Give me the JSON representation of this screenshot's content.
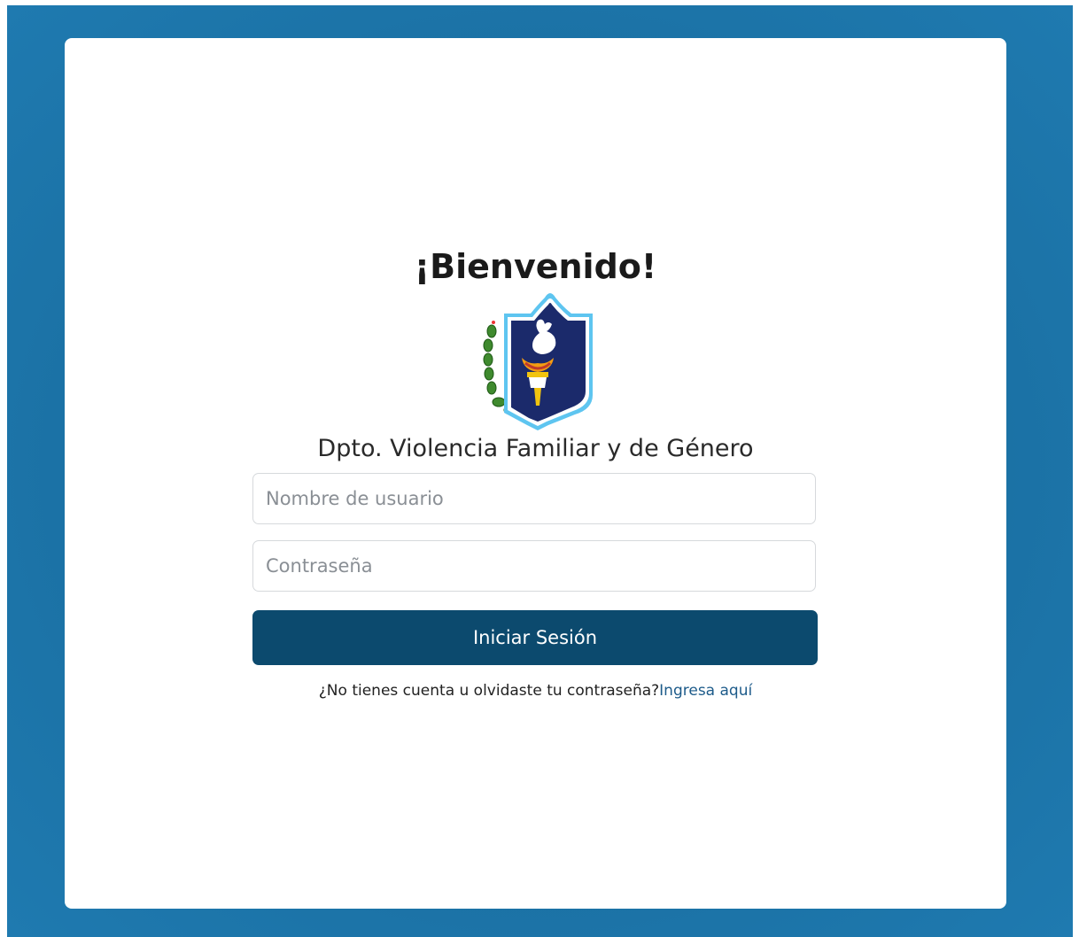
{
  "login": {
    "title": "¡Bienvenido!",
    "subtitle": "Dpto. Violencia Familiar y de Género",
    "username_placeholder": "Nombre de usuario",
    "password_placeholder": "Contraseña",
    "submit_label": "Iniciar Sesión",
    "help_text": "¿No tienes cuenta u olvidaste tu contraseña?",
    "help_link": "Ingresa aquí"
  },
  "colors": {
    "background": "#1a70a3",
    "button": "#0c4a6e",
    "link": "#1d5b8a"
  },
  "icons": {
    "logo": "police-shield-logo"
  }
}
